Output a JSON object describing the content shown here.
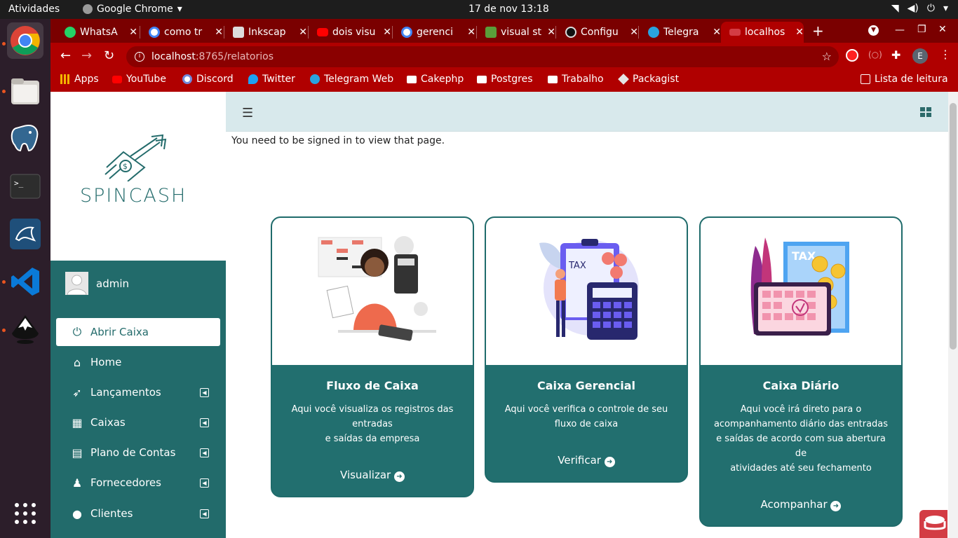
{
  "system": {
    "activities": "Atividades",
    "app_name": "Google Chrome",
    "clock": "17 de nov  13:18"
  },
  "browser": {
    "tabs": [
      {
        "title": "WhatsA",
        "color": "#25d366"
      },
      {
        "title": "como tr",
        "color": "#4285f4"
      },
      {
        "title": "Inkscap",
        "color": "#333333"
      },
      {
        "title": "dois visu",
        "color": "#ff0000"
      },
      {
        "title": "gerenci",
        "color": "#4285f4"
      },
      {
        "title": "visual st",
        "color": "#5a9e3a"
      },
      {
        "title": "Configu",
        "color": "#111111"
      },
      {
        "title": "Telegra",
        "color": "#2aa3df"
      },
      {
        "title": "localhos",
        "color": "#d33c44"
      }
    ],
    "url_host": "localhost",
    "url_path": ":8765/relatorios",
    "bookmarks": [
      "Apps",
      "YouTube",
      "Discord",
      "Twitter",
      "Telegram Web",
      "Cakephp",
      "Postgres",
      "Trabalho",
      "Packagist"
    ],
    "reading_list": "Lista de leitura",
    "profile_initial": "E"
  },
  "sidebar": {
    "brand": "SPINCASH",
    "user": "admin",
    "items": [
      {
        "label": "Abrir Caixa",
        "icon": "power-icon",
        "glyph": "⏻"
      },
      {
        "label": "Home",
        "icon": "home-icon",
        "glyph": "⌂"
      },
      {
        "label": "Lançamentos",
        "icon": "rocket-icon",
        "glyph": "➶"
      },
      {
        "label": "Caixas",
        "icon": "boxes-icon",
        "glyph": "▦"
      },
      {
        "label": "Plano de Contas",
        "icon": "file-invoice-icon",
        "glyph": "▤"
      },
      {
        "label": "Fornecedores",
        "icon": "user-tie-icon",
        "glyph": "♟"
      },
      {
        "label": "Clientes",
        "icon": "user-icon",
        "glyph": "●"
      }
    ]
  },
  "main": {
    "flash": "You need to be signed in to view that page.",
    "cards": [
      {
        "title": "Fluxo de Caixa",
        "desc": "Aqui você visualiza os registros das\nentradas\ne saídas da empresa",
        "link": "Visualizar"
      },
      {
        "title": "Caixa Gerencial",
        "desc": "Aqui você verifica o controle de seu\nfluxo de caixa",
        "link": "Verificar"
      },
      {
        "title": "Caixa Diário",
        "desc": "Aqui você irá direto para o\nacompanhamento diário das entradas\ne saídas de acordo com sua abertura de\natividades até seu fechamento",
        "link": "Acompanhar"
      }
    ]
  },
  "colors": {
    "sidebar": "#226b6b",
    "chrome_theme": "#b00000",
    "header": "#d8e9ec"
  }
}
